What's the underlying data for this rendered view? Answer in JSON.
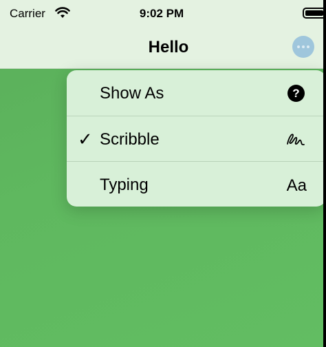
{
  "status_bar": {
    "carrier": "Carrier",
    "time": "9:02 PM"
  },
  "nav": {
    "title": "Hello"
  },
  "menu": {
    "items": [
      {
        "label": "Show As",
        "icon": "question-circle-icon",
        "checked": false
      },
      {
        "label": "Scribble",
        "icon": "scribble-icon",
        "checked": true
      },
      {
        "label": "Typing",
        "icon_text": "Aa",
        "checked": false
      }
    ],
    "check_glyph": "✓",
    "help_glyph": "?"
  },
  "colors": {
    "background_green": "#5fb85f",
    "nav_bar": "#e4f2e1",
    "menu_bg": "#d8f0d8",
    "more_button": "#9fc6dc"
  }
}
